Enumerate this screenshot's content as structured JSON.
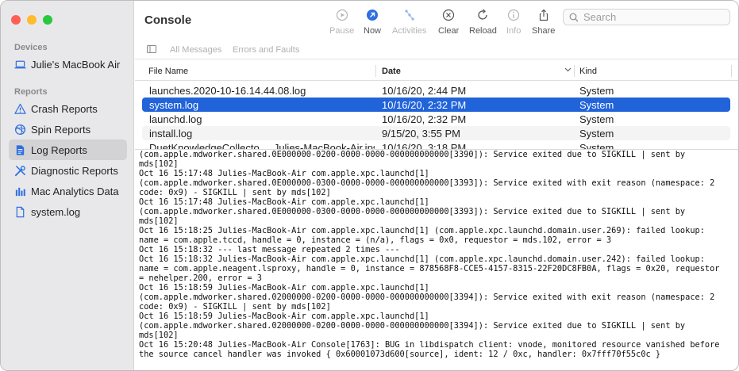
{
  "window": {
    "title": "Console"
  },
  "sidebar": {
    "devices_heading": "Devices",
    "device": "Julie's MacBook Air",
    "reports_heading": "Reports",
    "items": [
      {
        "label": "Crash Reports",
        "icon": "warning-triangle-icon"
      },
      {
        "label": "Spin Reports",
        "icon": "spin-icon"
      },
      {
        "label": "Log Reports",
        "icon": "document-icon",
        "selected": true
      },
      {
        "label": "Diagnostic Reports",
        "icon": "tools-icon"
      },
      {
        "label": "Mac Analytics Data",
        "icon": "bar-chart-icon"
      },
      {
        "label": "system.log",
        "icon": "file-icon"
      }
    ]
  },
  "toolbar": {
    "pause": "Pause",
    "now": "Now",
    "activities": "Activities",
    "clear": "Clear",
    "reload": "Reload",
    "info": "Info",
    "share": "Share",
    "search_placeholder": "Search"
  },
  "filters": {
    "all": "All Messages",
    "errors": "Errors and Faults"
  },
  "table": {
    "columns": [
      "File Name",
      "Date",
      "Kind"
    ],
    "rows": [
      {
        "name": "launches.2020-10-16.14.44.08.log",
        "date": "10/16/20, 2:44 PM",
        "kind": "System"
      },
      {
        "name": "system.log",
        "date": "10/16/20, 2:32 PM",
        "kind": "System",
        "selected": true
      },
      {
        "name": "launchd.log",
        "date": "10/16/20, 2:32 PM",
        "kind": "System"
      },
      {
        "name": "install.log",
        "date": "9/15/20, 3:55 PM",
        "kind": "System"
      },
      {
        "name": "DuetKnowledgeCollecto..._Julies-MacBook-Air.ips",
        "date": "10/16/20, 3:18 PM",
        "kind": "System"
      }
    ]
  },
  "log_lines": [
    "(com.apple.mdworker.shared.0E000000-0200-0000-0000-000000000000[3390]): Service exited due to SIGKILL | sent by",
    "mds[102]",
    "Oct 16 15:17:48 Julies-MacBook-Air com.apple.xpc.launchd[1]",
    "(com.apple.mdworker.shared.0E000000-0300-0000-0000-000000000000[3393]): Service exited with exit reason (namespace: 2",
    "code: 0x9) - SIGKILL | sent by mds[102]",
    "Oct 16 15:17:48 Julies-MacBook-Air com.apple.xpc.launchd[1]",
    "(com.apple.mdworker.shared.0E000000-0300-0000-0000-000000000000[3393]): Service exited due to SIGKILL | sent by",
    "mds[102]",
    "Oct 16 15:18:25 Julies-MacBook-Air com.apple.xpc.launchd[1] (com.apple.xpc.launchd.domain.user.269): failed lookup:",
    "name = com.apple.tccd, handle = 0, instance = (n/a), flags = 0x0, requestor = mds.102, error = 3",
    "Oct 16 15:18:32 --- last message repeated 2 times ---",
    "Oct 16 15:18:32 Julies-MacBook-Air com.apple.xpc.launchd[1] (com.apple.xpc.launchd.domain.user.242): failed lookup:",
    "name = com.apple.neagent.lsproxy, handle = 0, instance = 878568F8-CCE5-4157-8315-22F20DC8FB0A, flags = 0x20, requestor",
    "= nehelper.200, error = 3",
    "Oct 16 15:18:59 Julies-MacBook-Air com.apple.xpc.launchd[1]",
    "(com.apple.mdworker.shared.02000000-0200-0000-0000-000000000000[3394]): Service exited with exit reason (namespace: 2",
    "code: 0x9) - SIGKILL | sent by mds[102]",
    "Oct 16 15:18:59 Julies-MacBook-Air com.apple.xpc.launchd[1]",
    "(com.apple.mdworker.shared.02000000-0200-0000-0000-000000000000[3394]): Service exited due to SIGKILL | sent by",
    "mds[102]",
    "Oct 16 15:20:48 Julies-MacBook-Air Console[1763]: BUG in libdispatch client: vnode, monitored resource vanished before",
    "the source cancel handler was invoked { 0x60001073d600[source], ident: 12 / 0xc, handler: 0x7fff70f55c0c }"
  ],
  "colors": {
    "selection": "#2163d9",
    "accent": "#2163d9",
    "sidebar_bg": "#e8e8ea"
  }
}
